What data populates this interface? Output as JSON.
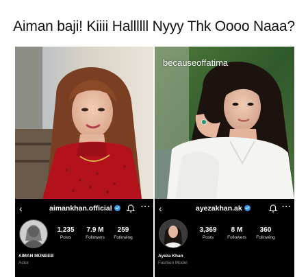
{
  "caption": "Aiman baji! Kiiii Hallllll Nyyy Thk Oooo Naaa?",
  "left_panel": {
    "username": "aimankhan.official",
    "stats": [
      {
        "value": "1,235",
        "label": "Posts"
      },
      {
        "value": "7.9 M",
        "label": "Followers"
      },
      {
        "value": "259",
        "label": "Following"
      }
    ],
    "display_name": "AIMAN MUNEEB",
    "category": "Actor"
  },
  "right_panel": {
    "watermark": "becauseoffatima",
    "username": "ayezakhan.ak",
    "stats": [
      {
        "value": "3,369",
        "label": "Posts"
      },
      {
        "value": "8 M",
        "label": "Followers"
      },
      {
        "value": "360",
        "label": "Following"
      }
    ],
    "display_name": "Ayeza Khan",
    "category": "Fashion Model"
  },
  "icons": {
    "back": "back-arrow-icon",
    "verified": "verified-badge-icon",
    "bell": "bell-icon",
    "more": "more-options-icon"
  },
  "colors": {
    "verified": "#3897f0",
    "profile_bg": "#000000",
    "left_dress": "#b3121c",
    "right_bg": "#2f5a2a"
  }
}
